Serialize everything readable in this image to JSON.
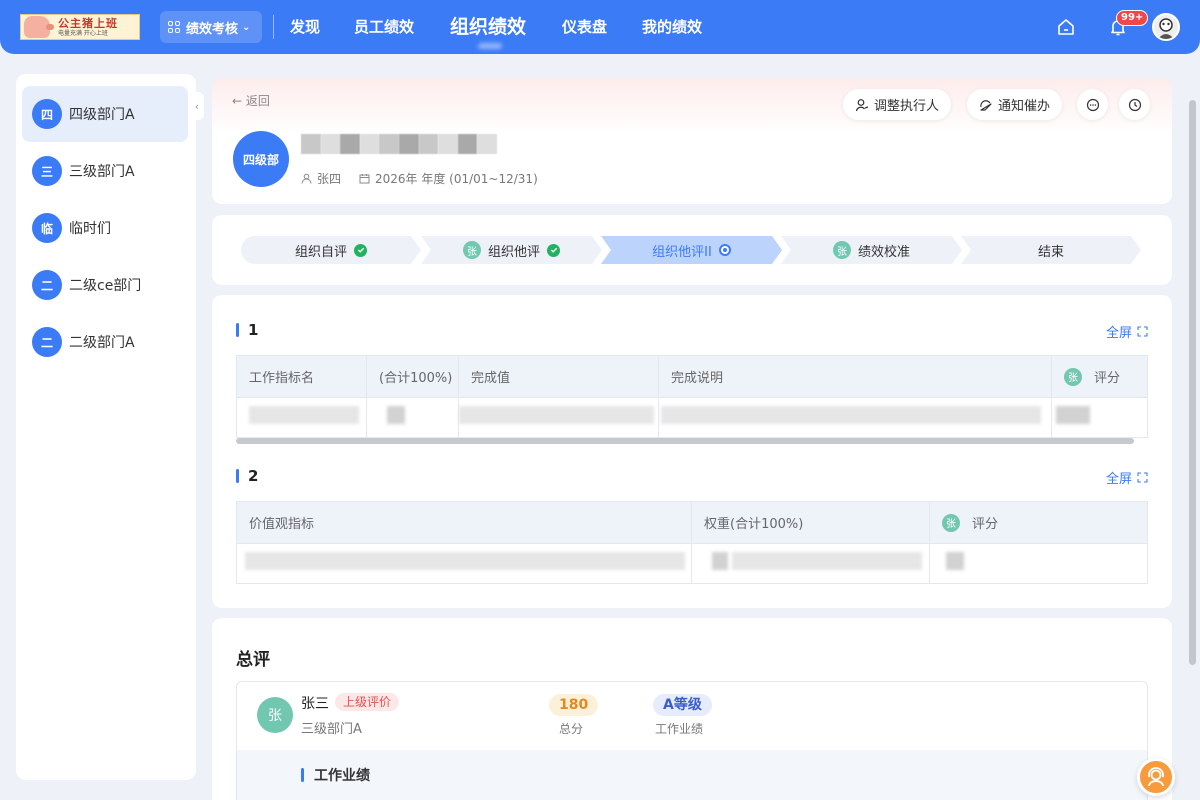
{
  "nav": {
    "logo_text": "公主猪上班",
    "logo_subtext": "电量充满 开心上班",
    "module_switch": "绩效考核",
    "items": [
      "发现",
      "员工绩效",
      "组织绩效",
      "仪表盘",
      "我的绩效"
    ],
    "active_item": "组织绩效",
    "notification_count": "99+"
  },
  "sidebar": {
    "items": [
      {
        "badge": "四",
        "label": "四级部门A",
        "active": true
      },
      {
        "badge": "三",
        "label": "三级部门A"
      },
      {
        "badge": "临",
        "label": "临时们"
      },
      {
        "badge": "二",
        "label": "二级ce部门"
      },
      {
        "badge": "二",
        "label": "二级部门A"
      }
    ]
  },
  "header": {
    "back": "← 返回",
    "avatar_text": "四级部",
    "owner": "张四",
    "period": "2026年 年度 (01/01~12/31)",
    "actions": {
      "adjust_executor": "调整执行人",
      "notify": "通知催办"
    }
  },
  "steps": [
    {
      "label": "组织自评",
      "status": "done"
    },
    {
      "label": "组织他评",
      "avatar": "张",
      "status": "done"
    },
    {
      "label": "组织他评II",
      "status": "active"
    },
    {
      "label": "绩效校准",
      "avatar": "张",
      "status": "pending"
    },
    {
      "label": "结束",
      "status": "pending"
    }
  ],
  "section1": {
    "title": "1",
    "fullscreen": "全屏",
    "columns": [
      "工作指标名",
      "(合计100%)",
      "完成值",
      "完成说明",
      "评分"
    ],
    "score_avatar": "张"
  },
  "section2": {
    "title": "2",
    "fullscreen": "全屏",
    "columns": [
      "价值观指标",
      "权重(合计100%)",
      "评分"
    ],
    "score_avatar": "张"
  },
  "summary": {
    "title": "总评",
    "avatar": "张",
    "name": "张三",
    "tag": "上级评价",
    "dept": "三级部门A",
    "score_value": "180",
    "score_label": "总分",
    "grade_value": "A等级",
    "grade_label": "工作业绩",
    "sub_title": "工作业绩"
  },
  "colors": {
    "primary": "#3b7bf6",
    "success": "#21b35f",
    "danger": "#f04848",
    "avatar_green": "#72c7b1"
  }
}
